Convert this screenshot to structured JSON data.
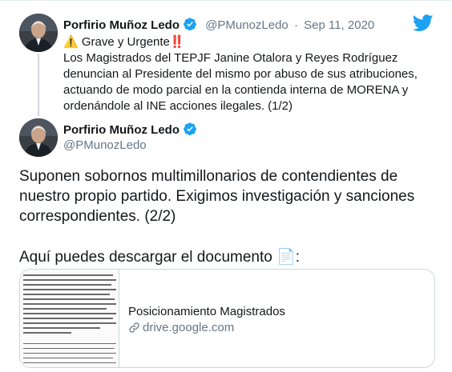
{
  "reply_tweet": {
    "author_name": "Porfirio Muñoz Ledo",
    "handle": "@PMunozLedo",
    "separator": "·",
    "date": "Sep 11, 2020",
    "lines": [
      "⚠️ Grave y Urgente‼️",
      "Los Magistrados del TEPJF Janine Otalora y Reyes Rodríguez",
      "denuncian al Presidente del mismo por abuso de sus atribuciones,",
      "actuando de modo parcial en la contienda interna de MORENA y",
      "ordenándole al INE acciones ilegales. (1/2)"
    ]
  },
  "main_tweet": {
    "author_name": "Porfirio Muñoz Ledo",
    "handle": "@PMunozLedo",
    "lines": [
      "Suponen sobornos multimillonarios de contendientes de",
      "nuestro propio partido. Exigimos investigación y sanciones",
      "correspondientes. (2/2)"
    ],
    "download_line": "Aquí puedes descargar el documento 📄:"
  },
  "link_card": {
    "title": "Posicionamiento Magistrados",
    "domain": "drive.google.com"
  },
  "icons": {
    "brand": "twitter-bird-icon",
    "verified": "verified-badge-icon",
    "link": "link-icon"
  },
  "colors": {
    "brand_blue": "#1da1f2",
    "text": "#14171a",
    "muted": "#657786",
    "border": "#ccd6dd"
  }
}
